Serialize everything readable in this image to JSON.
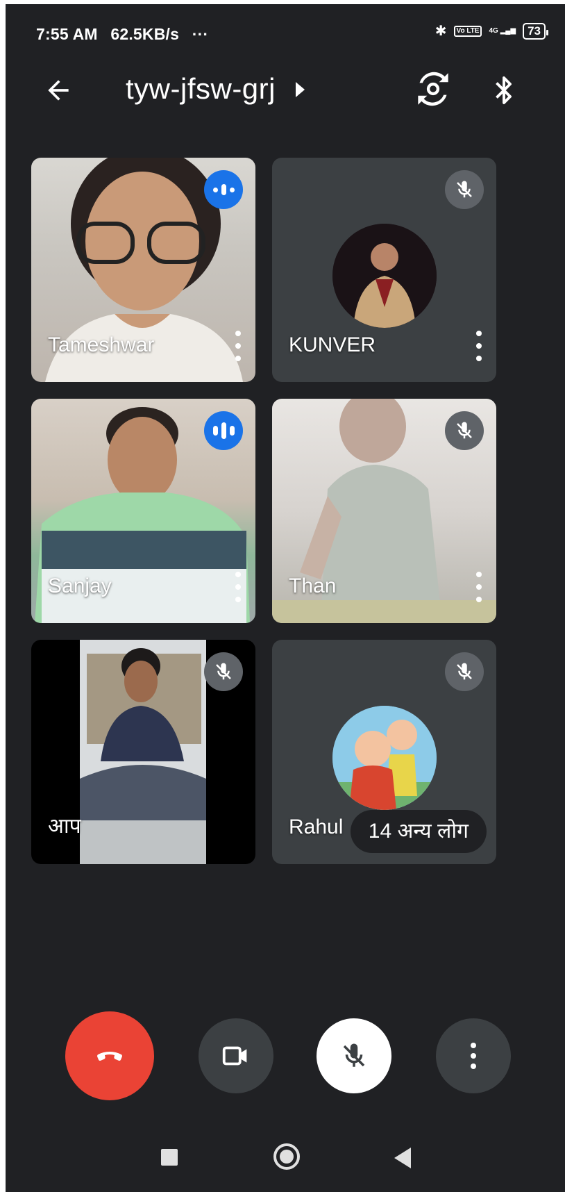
{
  "status_bar": {
    "time": "7:55 AM",
    "speed": "62.5KB/s",
    "more": "···",
    "network_volte": "Vo LTE",
    "network_type": "4G",
    "battery": "73"
  },
  "header": {
    "meeting_code": "tyw-jfsw-grj",
    "icons": [
      "back-arrow-icon",
      "switch-camera-icon",
      "bluetooth-icon"
    ]
  },
  "participants": [
    {
      "name": "Tameshwar",
      "state": "speaking",
      "video": true
    },
    {
      "name": "KUNVER",
      "state": "muted",
      "video": false
    },
    {
      "name": "Sanjay",
      "state": "speaking",
      "video": true
    },
    {
      "name": "Than",
      "state": "muted",
      "video": true
    },
    {
      "name": "आप",
      "state": "muted",
      "video": true
    },
    {
      "name": "Rahul",
      "state": "muted",
      "video": false
    }
  ],
  "others_chip": "14 अन्य लोग",
  "controls": {
    "end_call_color": "#ea4335",
    "icons": [
      "end-call-icon",
      "camera-icon",
      "mic-off-icon",
      "more-options-icon"
    ]
  },
  "colors": {
    "background": "#202124",
    "tile": "#3c4043",
    "speaking_badge": "#1a73e8",
    "muted_badge": "#5f6368"
  }
}
